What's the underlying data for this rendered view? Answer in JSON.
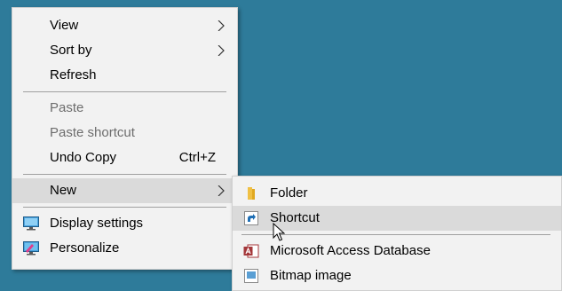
{
  "desktop": {
    "background_color": "#2e7b9a"
  },
  "context_menu": {
    "items": [
      {
        "label": "View",
        "submenu": true
      },
      {
        "label": "Sort by",
        "submenu": true
      },
      {
        "label": "Refresh"
      },
      {
        "label": "Paste",
        "disabled": true
      },
      {
        "label": "Paste shortcut",
        "disabled": true
      },
      {
        "label": "Undo Copy",
        "accelerator": "Ctrl+Z"
      },
      {
        "label": "New",
        "submenu": true,
        "highlighted": true
      },
      {
        "label": "Display settings",
        "icon": "display-settings-icon"
      },
      {
        "label": "Personalize",
        "icon": "personalize-icon"
      }
    ]
  },
  "new_submenu": {
    "items": [
      {
        "label": "Folder",
        "icon": "folder-icon"
      },
      {
        "label": "Shortcut",
        "icon": "shortcut-icon",
        "highlighted": true
      },
      {
        "label": "Microsoft Access Database",
        "icon": "access-database-icon"
      },
      {
        "label": "Bitmap image",
        "icon": "bitmap-image-icon"
      }
    ]
  }
}
